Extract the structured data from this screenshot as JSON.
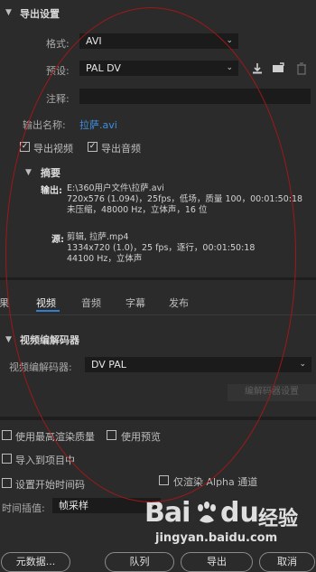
{
  "export_settings": {
    "title": "导出设置",
    "format_label": "格式:",
    "format_value": "AVI",
    "preset_label": "预设:",
    "preset_value": "PAL DV",
    "comment_label": "注释:",
    "output_name_label": "输出名称:",
    "output_name_value": "拉萨.avi",
    "export_video_label": "导出视频",
    "export_audio_label": "导出音频",
    "export_video_checked": true,
    "export_audio_checked": true
  },
  "summary": {
    "title": "摘要",
    "output_key": "输出:",
    "output_lines": [
      "E:\\360用户文件\\拉萨.avi",
      "720x576 (1.094)，25fps，低场，质量 100，00:01:50:18",
      "未压缩，48000 Hz，立体声，16 位"
    ],
    "source_key": "源:",
    "source_lines": [
      "剪辑, 拉萨.mp4",
      "1334x720 (1.0)，25 fps，逐行，00:01:50:18",
      "44100 Hz，立体声"
    ]
  },
  "tabs": [
    {
      "label": "效果",
      "active": false
    },
    {
      "label": "视频",
      "active": true
    },
    {
      "label": "音频",
      "active": false
    },
    {
      "label": "字幕",
      "active": false
    },
    {
      "label": "发布",
      "active": false
    }
  ],
  "video_codec": {
    "title": "视频编解码器",
    "codec_label": "视频编解码器:",
    "codec_value": "DV PAL",
    "codec_settings_button": "编解码器设置"
  },
  "options": {
    "max_render_quality": "使用最高渲染质量",
    "use_preview": "使用预览",
    "import_into_project": "导入到项目中",
    "set_start_timecode": "设置开始时间码",
    "render_alpha_only": "仅渲染 Alpha 通道",
    "time_interpolation_label": "时间插值:",
    "time_interpolation_value": "帧采样"
  },
  "buttons": {
    "metadata": "元数据...",
    "queue": "队列",
    "export": "导出",
    "cancel": "取消"
  },
  "watermark": {
    "brand": "Bai",
    "brand_suffix": "du",
    "brand_cn": "经验",
    "url": "jingyan.baidu.com"
  },
  "colors": {
    "background": "#2b2b2b",
    "link": "#3f8fe0",
    "annotation": "#a01818"
  }
}
